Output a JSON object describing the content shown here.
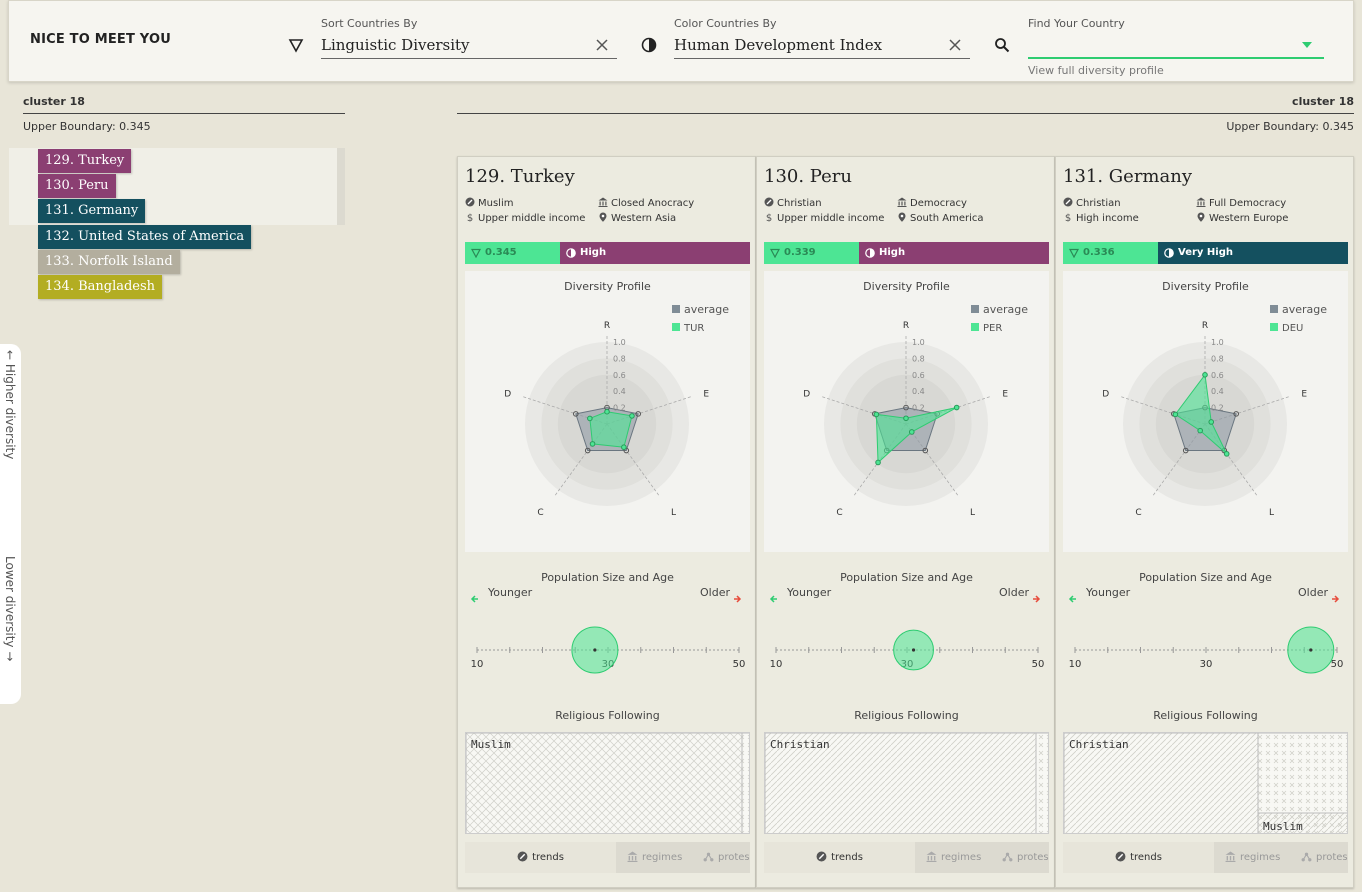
{
  "header": {
    "brand": "NICE TO MEET YOU",
    "sort": {
      "label": "Sort Countries By",
      "value": "Linguistic Diversity"
    },
    "color": {
      "label": "Color Countries By",
      "value": "Human Development Index"
    },
    "find": {
      "label": "Find Your Country",
      "value": "",
      "hint": "View full diversity profile"
    }
  },
  "left_cluster": {
    "name": "cluster 18",
    "boundary": "Upper Boundary: 0.345"
  },
  "right_cluster": {
    "name": "cluster 18",
    "boundary": "Upper Boundary: 0.345"
  },
  "country_list": [
    {
      "label": "129.  Turkey",
      "color": "#8b3f72"
    },
    {
      "label": "130.  Peru",
      "color": "#8b3f72"
    },
    {
      "label": "131.  Germany",
      "color": "#14505f"
    },
    {
      "label": "132.  United States of America",
      "color": "#14505f"
    },
    {
      "label": "133.  Norfolk Island",
      "color": "#b3ae9e"
    },
    {
      "label": "134.  Bangladesh",
      "color": "#b3ad22"
    }
  ],
  "axis": {
    "higher": "← Higher diversity",
    "lower": "Lower diversity →"
  },
  "chart_common": {
    "radar_title": "Diversity Profile",
    "legend_avg": "average",
    "axes": [
      "R",
      "E",
      "L",
      "C",
      "D"
    ],
    "rings": [
      "1.0",
      "0.8",
      "0.6",
      "0.4",
      "0.2"
    ],
    "pop_title": "Population Size and Age",
    "younger": "Younger",
    "older": "Older",
    "ticks": [
      "10",
      "30",
      "50"
    ],
    "rel_title": "Religious Following",
    "tab_trends": "trends",
    "tab_regimes": "regimes",
    "tab_protests": "protes"
  },
  "cards": [
    {
      "title": "129. Turkey",
      "religion": "Muslim",
      "regime": "Closed Anocracy",
      "income": "Upper middle income",
      "region": "Western Asia",
      "score": "0.345",
      "hdi": "High",
      "hdi_color": "#8b3f72",
      "code": "TUR",
      "radar": {
        "avg": [
          0.2,
          0.4,
          0.4,
          0.4,
          0.4
        ],
        "country": [
          0.15,
          0.32,
          0.35,
          0.3,
          0.22
        ]
      },
      "pop": {
        "median_age": 28,
        "size": 1.0
      },
      "religions": [
        {
          "name": "Muslim",
          "share": 0.97
        }
      ]
    },
    {
      "title": "130. Peru",
      "religion": "Christian",
      "regime": "Democracy",
      "income": "Upper middle income",
      "region": "South America",
      "score": "0.339",
      "hdi": "High",
      "hdi_color": "#8b3f72",
      "code": "PER",
      "radar": {
        "avg": [
          0.2,
          0.4,
          0.4,
          0.4,
          0.4
        ],
        "country": [
          0.07,
          0.65,
          0.12,
          0.58,
          0.38
        ]
      },
      "pop": {
        "median_age": 31,
        "size": 0.75
      },
      "religions": [
        {
          "name": "Christian",
          "share": 0.95
        }
      ]
    },
    {
      "title": "131. Germany",
      "religion": "Christian",
      "regime": "Full Democracy",
      "income": "High income",
      "region": "Western Europe",
      "score": "0.336",
      "hdi": "Very High",
      "hdi_color": "#14505f",
      "code": "DEU",
      "radar": {
        "avg": [
          0.2,
          0.4,
          0.4,
          0.4,
          0.4
        ],
        "country": [
          0.6,
          0.08,
          0.45,
          0.1,
          0.38
        ]
      },
      "pop": {
        "median_age": 46,
        "size": 1.0
      },
      "religions": [
        {
          "name": "Christian",
          "share": 0.68
        },
        {
          "name": "Muslim",
          "share": 0.06
        }
      ]
    }
  ],
  "colors": {
    "green": "#4de594",
    "magenta": "#8b3f72",
    "teal": "#14505f",
    "average": "#7f8c96"
  }
}
